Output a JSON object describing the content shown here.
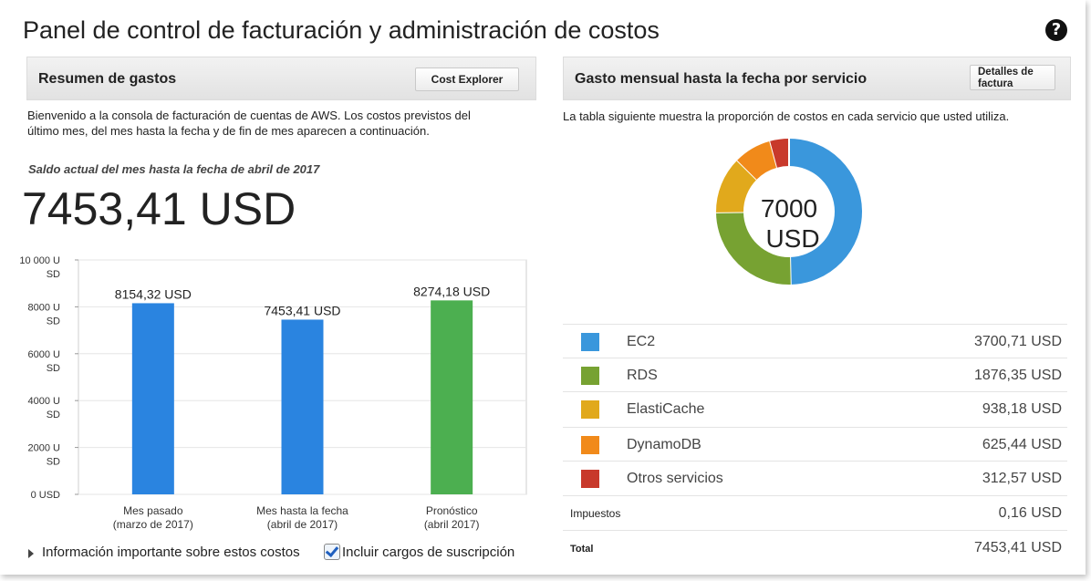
{
  "page": {
    "title": "Panel de control de facturación y administración de costos",
    "help_icon": "?"
  },
  "summary": {
    "header": "Resumen de gastos",
    "button": "Cost Explorer",
    "description_line1": "Bienvenido a la consola de facturación de cuentas de AWS. Los costos previstos del",
    "description_line2": "último mes, del mes hasta la fecha y de fin de mes aparecen a continuación.",
    "subheading": "Saldo actual del mes hasta la fecha de abril de 2017",
    "balance": "7453,41 USD"
  },
  "chart_data": {
    "type": "bar",
    "categories": [
      "Mes pasado\n(marzo de 2017)",
      "Mes hasta la fecha\n(abril de 2017)",
      "Pronóstico\n(abril 2017)"
    ],
    "category_lines": [
      [
        "Mes pasado",
        "(marzo de 2017)"
      ],
      [
        "Mes hasta la fecha",
        "(abril de 2017)"
      ],
      [
        "Pronóstico",
        "(abril 2017)"
      ]
    ],
    "values": [
      8154.32,
      7453.41,
      8274.18
    ],
    "data_labels": [
      "8154,32 USD",
      "7453,41 USD",
      "8274,18 USD"
    ],
    "colors": [
      "#2a84e0",
      "#2a84e0",
      "#4caf50"
    ],
    "ylim": [
      0,
      10000
    ],
    "yticks": [
      {
        "value": 10000,
        "lines": [
          "10 000 U",
          "SD"
        ]
      },
      {
        "value": 8000,
        "lines": [
          "8000 U",
          "SD"
        ]
      },
      {
        "value": 6000,
        "lines": [
          "6000 U",
          "SD"
        ]
      },
      {
        "value": 4000,
        "lines": [
          "4000 U",
          "SD"
        ]
      },
      {
        "value": 2000,
        "lines": [
          "2000 U",
          "SD"
        ]
      },
      {
        "value": 0,
        "lines": [
          "0 USD"
        ]
      }
    ],
    "grid": true
  },
  "footer": {
    "info_link": "Información importante sobre estos costos",
    "checkbox_label": "Incluir cargos de suscripción",
    "checkbox_checked": true
  },
  "services": {
    "header": "Gasto mensual hasta la fecha por servicio",
    "button_line1": "Detalles de",
    "button_line2": "factura",
    "description": "La tabla siguiente muestra la proporción de costos en cada servicio que usted utiliza.",
    "donut_center_line1": "7000",
    "donut_center_line2": "USD",
    "donut": {
      "type": "pie",
      "values": [
        3700.71,
        1876.35,
        938.18,
        625.44,
        312.57
      ],
      "colors": [
        "#3a97dc",
        "#77a232",
        "#e1a91c",
        "#f18a1a",
        "#c8392b"
      ]
    },
    "rows": [
      {
        "name": "EC2",
        "value": "3700,71 USD",
        "color": "#3a97dc"
      },
      {
        "name": "RDS",
        "value": "1876,35 USD",
        "color": "#77a232"
      },
      {
        "name": "ElastiCache",
        "value": "938,18 USD",
        "color": "#e1a91c"
      },
      {
        "name": "DynamoDB",
        "value": "625,44 USD",
        "color": "#f18a1a"
      },
      {
        "name": "Otros servicios",
        "value": "312,57 USD",
        "color": "#c8392b"
      }
    ],
    "tax_label": "Impuestos",
    "tax_value": "0,16 USD",
    "total_label": "Total",
    "total_value": "7453,41 USD"
  }
}
